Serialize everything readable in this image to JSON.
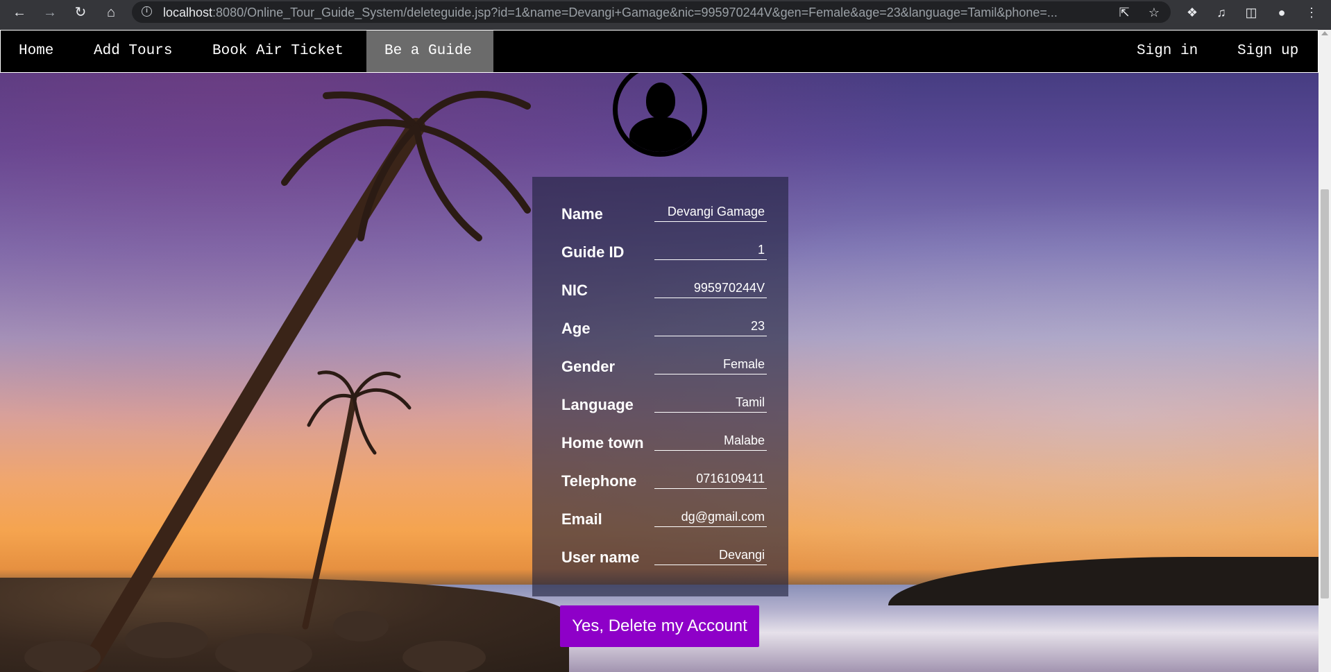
{
  "browser": {
    "url_host": "localhost",
    "url_rest": ":8080/Online_Tour_Guide_System/deleteguide.jsp?id=1&name=Devangi+Gamage&nic=995970244V&gen=Female&age=23&language=Tamil&phone=..."
  },
  "nav": {
    "items": [
      "Home",
      "Add Tours",
      "Book Air Ticket",
      "Be a Guide"
    ],
    "right_items": [
      "Sign in",
      "Sign up"
    ],
    "active": "Be a Guide"
  },
  "guide": {
    "fields": [
      {
        "label": "Name",
        "value": "Devangi Gamage"
      },
      {
        "label": "Guide ID",
        "value": "1"
      },
      {
        "label": "NIC",
        "value": "995970244V"
      },
      {
        "label": "Age",
        "value": "23"
      },
      {
        "label": "Gender",
        "value": "Female"
      },
      {
        "label": "Language",
        "value": "Tamil"
      },
      {
        "label": "Home town",
        "value": "Malabe"
      },
      {
        "label": "Telephone",
        "value": "0716109411"
      },
      {
        "label": "Email",
        "value": "dg@gmail.com"
      },
      {
        "label": "User name",
        "value": "Devangi"
      }
    ]
  },
  "actions": {
    "delete_label": "Yes, Delete my Account"
  },
  "colors": {
    "delete_button": "#8e00c8",
    "nav_active": "#6b6b6b"
  }
}
